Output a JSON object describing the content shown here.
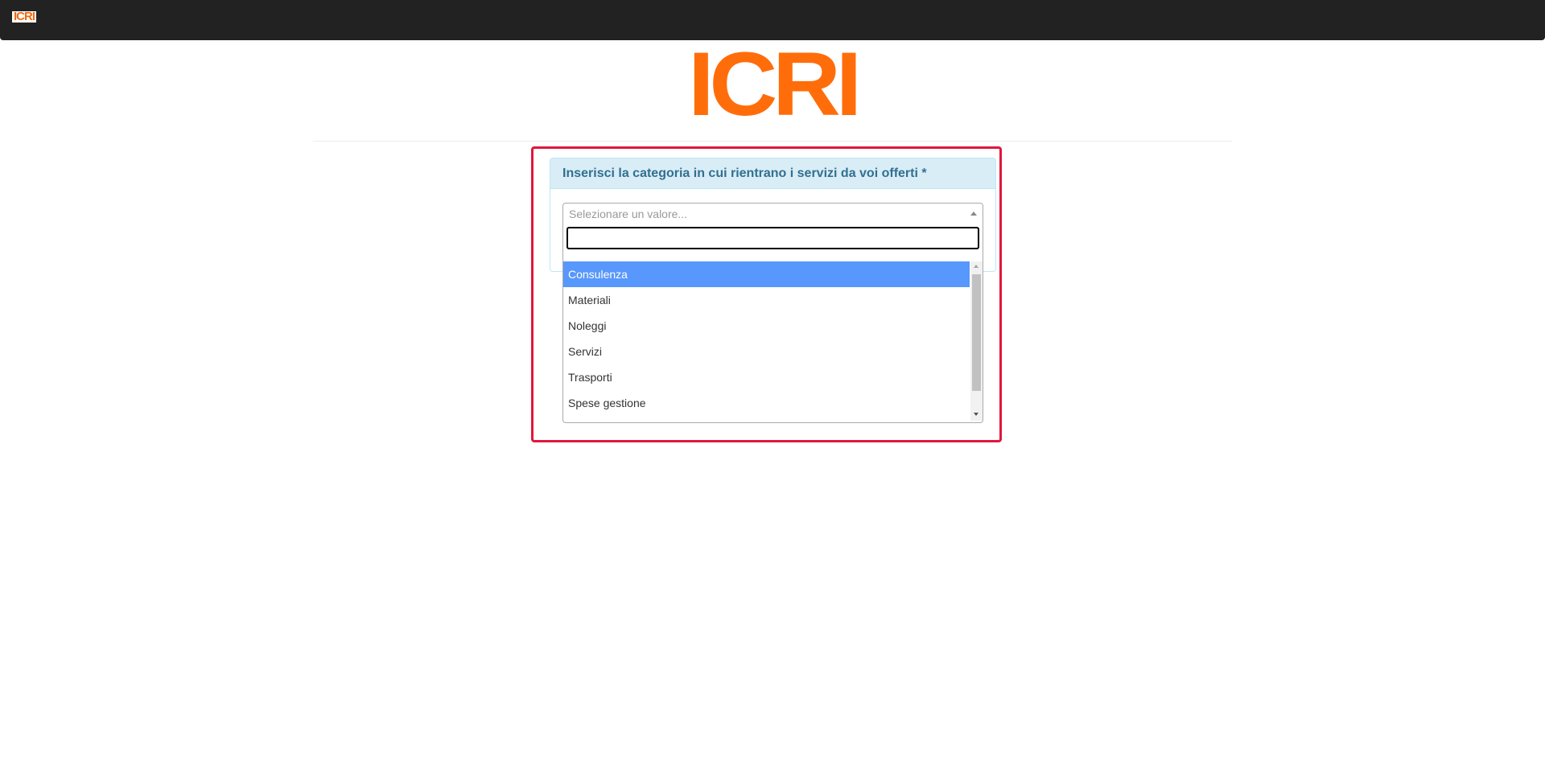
{
  "navbar": {
    "logo_text": "ICRI"
  },
  "header": {
    "logo_text": "ICRI"
  },
  "form": {
    "category_label": "Inserisci la categoria in cui rientrano i servizi da voi offerti *",
    "select": {
      "placeholder": "Selezionare un valore...",
      "search_value": "",
      "options": [
        {
          "label": "Consulenza",
          "highlighted": true
        },
        {
          "label": "Materiali"
        },
        {
          "label": "Noleggi"
        },
        {
          "label": "Servizi"
        },
        {
          "label": "Trasporti"
        },
        {
          "label": "Spese gestione"
        }
      ]
    }
  },
  "colors": {
    "brand_orange": "#ff6d0a",
    "navbar_bg": "#222222",
    "highlight_border": "#e0173c",
    "panel_heading_bg": "#d9edf7",
    "panel_heading_text": "#31708f",
    "option_selected_bg": "#5897fb"
  },
  "icons": {
    "select_arrow": "chevron-up-icon",
    "scroll_up": "scroll-up-arrow-icon",
    "scroll_down": "scroll-down-arrow-icon"
  }
}
